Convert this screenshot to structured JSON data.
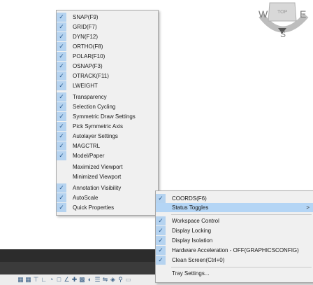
{
  "viewcube": {
    "west": "W",
    "top": "TOP",
    "east": "E",
    "south": "S"
  },
  "customization_menu": {
    "items": [
      {
        "label": "SNAP(F9)",
        "checked": true
      },
      {
        "label": "GRID(F7)",
        "checked": true
      },
      {
        "label": "DYN(F12)",
        "checked": true
      },
      {
        "label": "ORTHO(F8)",
        "checked": true
      },
      {
        "label": "POLAR(F10)",
        "checked": true
      },
      {
        "label": "OSNAP(F3)",
        "checked": true
      },
      {
        "label": "OTRACK(F11)",
        "checked": true
      },
      {
        "label": "LWEIGHT",
        "checked": true
      },
      {
        "label": "Transparency",
        "checked": true
      },
      {
        "label": "Selection Cycling",
        "checked": true
      },
      {
        "label": "Symmetric Draw Settings",
        "checked": true
      },
      {
        "label": "Pick Symmetric Axis",
        "checked": true
      },
      {
        "label": "Autolayer Settings",
        "checked": true
      },
      {
        "label": "MAGCTRL",
        "checked": true
      },
      {
        "label": "Model/Paper",
        "checked": true
      },
      {
        "label": "Maximized Viewport",
        "checked": false
      },
      {
        "label": "Minimized Viewport",
        "checked": false
      },
      {
        "label": "Annotation Visibility",
        "checked": true
      },
      {
        "label": "AutoScale",
        "checked": true
      },
      {
        "label": "Quick Properties",
        "checked": true
      }
    ]
  },
  "tray_menu": {
    "coords": {
      "label": "COORDS(F6)",
      "checked": true
    },
    "status_toggles": {
      "label": "Status Toggles",
      "arrow": ">"
    },
    "items": [
      {
        "label": "Workspace Control",
        "checked": true
      },
      {
        "label": "Display Locking",
        "checked": true
      },
      {
        "label": "Display Isolation",
        "checked": true
      },
      {
        "label": "Hardware Acceleration - OFF(GRAPHICSCONFIG)",
        "checked": true
      },
      {
        "label": "Clean Screen(Ctrl+0)",
        "checked": true
      }
    ],
    "tray_settings": {
      "label": "Tray Settings..."
    }
  },
  "colors": {
    "check_bg": "#b5d3f0",
    "highlight": "#b4d5f5",
    "menu_bg": "#f0f0f0"
  }
}
